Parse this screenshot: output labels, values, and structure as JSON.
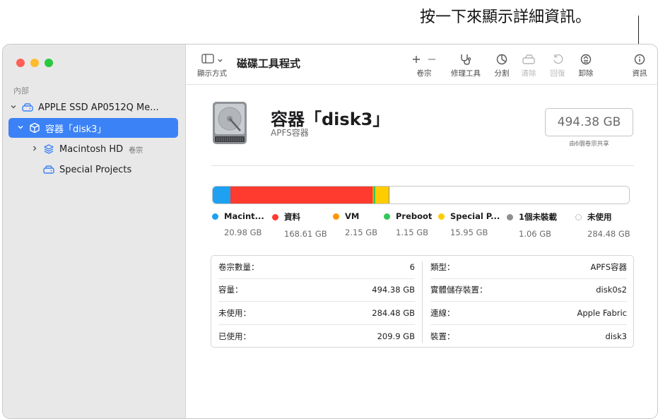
{
  "callout": "按一下來顯示詳細資訊。",
  "colors": {
    "selection": "#3b82f6",
    "sidebar_icon": "#3b82f6",
    "macintosh": "#1ea1f1",
    "data": "#ff3b30",
    "vm": "#ff9500",
    "preboot": "#34c759",
    "special": "#ffcc00",
    "unmounted": "#8e8e93",
    "free": "#ffffff"
  },
  "sidebar": {
    "section": "內部",
    "items": [
      {
        "label": "APPLE SSD AP0512Q Me...",
        "sub": "",
        "icon": "disk-icon"
      },
      {
        "label": "容器「disk3」",
        "sub": "",
        "icon": "container-icon"
      },
      {
        "label": "Macintosh HD",
        "sub": "卷宗",
        "icon": "volume-stack-icon"
      },
      {
        "label": "Special Projects",
        "sub": "",
        "icon": "disk-icon"
      }
    ]
  },
  "toolbar": {
    "view_label": "顯示方式",
    "title": "磁碟工具程式",
    "buttons": [
      {
        "label": "卷宗",
        "icon": "plus-minus-icon",
        "enabled": true
      },
      {
        "label": "修理工具",
        "icon": "stethoscope-icon",
        "enabled": true
      },
      {
        "label": "分割",
        "icon": "pie-icon",
        "enabled": true
      },
      {
        "label": "清除",
        "icon": "eraser-icon",
        "enabled": false
      },
      {
        "label": "回復",
        "icon": "restore-icon",
        "enabled": false
      },
      {
        "label": "卸除",
        "icon": "eject-icon",
        "enabled": true
      },
      {
        "label": "資訊",
        "icon": "info-icon",
        "enabled": true
      }
    ]
  },
  "volume": {
    "title": "容器「disk3」",
    "subtitle": "APFS容器",
    "capacity": "494.38 GB",
    "capacity_note": "由6個卷宗共享"
  },
  "usage": [
    {
      "name": "Macint...",
      "value": "20.98 GB",
      "gb": 20.98,
      "color": "#1ea1f1"
    },
    {
      "name": "資料",
      "value": "168.61 GB",
      "gb": 168.61,
      "color": "#ff3b30"
    },
    {
      "name": "VM",
      "value": "2.15 GB",
      "gb": 2.15,
      "color": "#ff9500"
    },
    {
      "name": "Preboot",
      "value": "1.15 GB",
      "gb": 1.15,
      "color": "#34c759"
    },
    {
      "name": "Special P...",
      "value": "15.95 GB",
      "gb": 15.95,
      "color": "#ffcc00"
    },
    {
      "name": "1個未裝載",
      "value": "1.06 GB",
      "gb": 1.06,
      "color": "#8e8e93"
    },
    {
      "name": "未使用",
      "value": "284.48 GB",
      "gb": 284.48,
      "color": "#ffffff"
    }
  ],
  "info": {
    "left": [
      {
        "key": "卷宗數量：",
        "value": "6"
      },
      {
        "key": "容量：",
        "value": "494.38 GB"
      },
      {
        "key": "未使用：",
        "value": "284.48 GB"
      },
      {
        "key": "已使用：",
        "value": "209.9 GB"
      }
    ],
    "right": [
      {
        "key": "類型：",
        "value": "APFS容器"
      },
      {
        "key": "實體儲存裝置：",
        "value": "disk0s2"
      },
      {
        "key": "連線：",
        "value": "Apple Fabric"
      },
      {
        "key": "裝置：",
        "value": "disk3"
      }
    ]
  }
}
